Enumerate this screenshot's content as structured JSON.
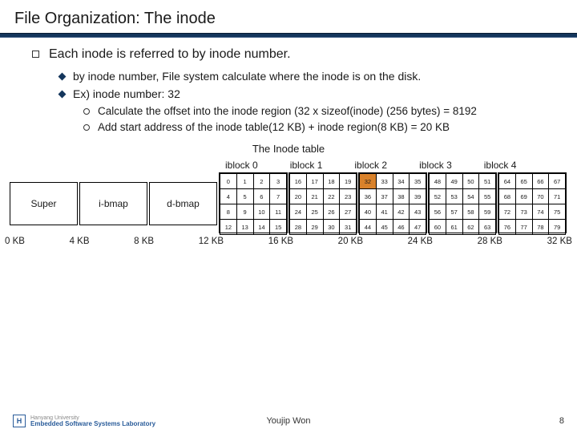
{
  "title": "File Organization: The inode",
  "bullets": {
    "lvl1": "Each inode is referred to by inode number.",
    "lvl2a": "by inode number, File system calculate where the inode is on the disk.",
    "lvl2b": "Ex) inode number: 32",
    "lvl3a": "Calculate the offset into the inode region (32 x sizeof(inode) (256 bytes) = 8192",
    "lvl3b": "Add start address of the inode table(12 KB) + inode region(8 KB) = 20 KB"
  },
  "table_caption": "The Inode table",
  "iblocks": [
    "iblock 0",
    "iblock 1",
    "iblock 2",
    "iblock 3",
    "iblock 4"
  ],
  "big_blocks": {
    "super": "Super",
    "ibmap": "i-bmap",
    "dbmap": "d-bmap"
  },
  "grids": [
    [
      [
        0,
        1,
        2,
        3
      ],
      [
        4,
        5,
        6,
        7
      ],
      [
        8,
        9,
        10,
        11
      ],
      [
        12,
        13,
        14,
        15
      ]
    ],
    [
      [
        16,
        17,
        18,
        19
      ],
      [
        20,
        21,
        22,
        23
      ],
      [
        24,
        25,
        26,
        27
      ],
      [
        28,
        29,
        30,
        31
      ]
    ],
    [
      [
        32,
        33,
        34,
        35
      ],
      [
        36,
        37,
        38,
        39
      ],
      [
        40,
        41,
        42,
        43
      ],
      [
        44,
        45,
        46,
        47
      ]
    ],
    [
      [
        48,
        49,
        50,
        51
      ],
      [
        52,
        53,
        54,
        55
      ],
      [
        56,
        57,
        58,
        59
      ],
      [
        60,
        61,
        62,
        63
      ]
    ],
    [
      [
        64,
        65,
        66,
        67
      ],
      [
        68,
        69,
        70,
        71
      ],
      [
        72,
        73,
        74,
        75
      ],
      [
        76,
        77,
        78,
        79
      ]
    ]
  ],
  "highlight": 32,
  "kb_marks": [
    "0 KB",
    "4 KB",
    "8 KB",
    "12 KB",
    "16 KB",
    "20 KB",
    "24 KB",
    "28 KB",
    "32 KB"
  ],
  "footer": {
    "uni": "Hanyang University",
    "lab": "Embedded Software Systems Laboratory",
    "author": "Youjip Won",
    "page": "8"
  }
}
